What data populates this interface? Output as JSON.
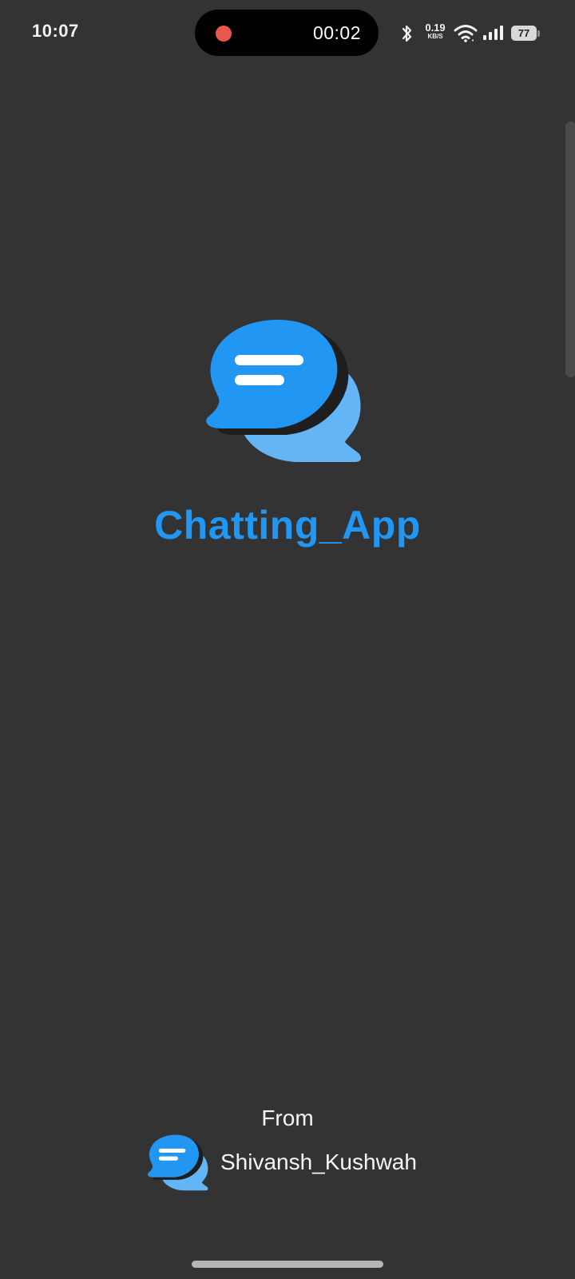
{
  "status_bar": {
    "time": "10:07",
    "recording_timer": "00:02",
    "net_speed_value": "0.19",
    "net_speed_unit": "KB/S",
    "battery_level": "77",
    "icons": [
      "bluetooth-icon",
      "wifi-icon",
      "signal-icon",
      "battery-icon"
    ]
  },
  "splash": {
    "title": "Chatting_App",
    "logo_icon": "chat-bubbles-icon",
    "footer_from": "From",
    "author": "Shivansh_Kushwah"
  },
  "colors": {
    "background": "#333333",
    "accent": "#2196f3",
    "accent_light": "#64b5f6",
    "recording_dot": "#e8584e"
  }
}
